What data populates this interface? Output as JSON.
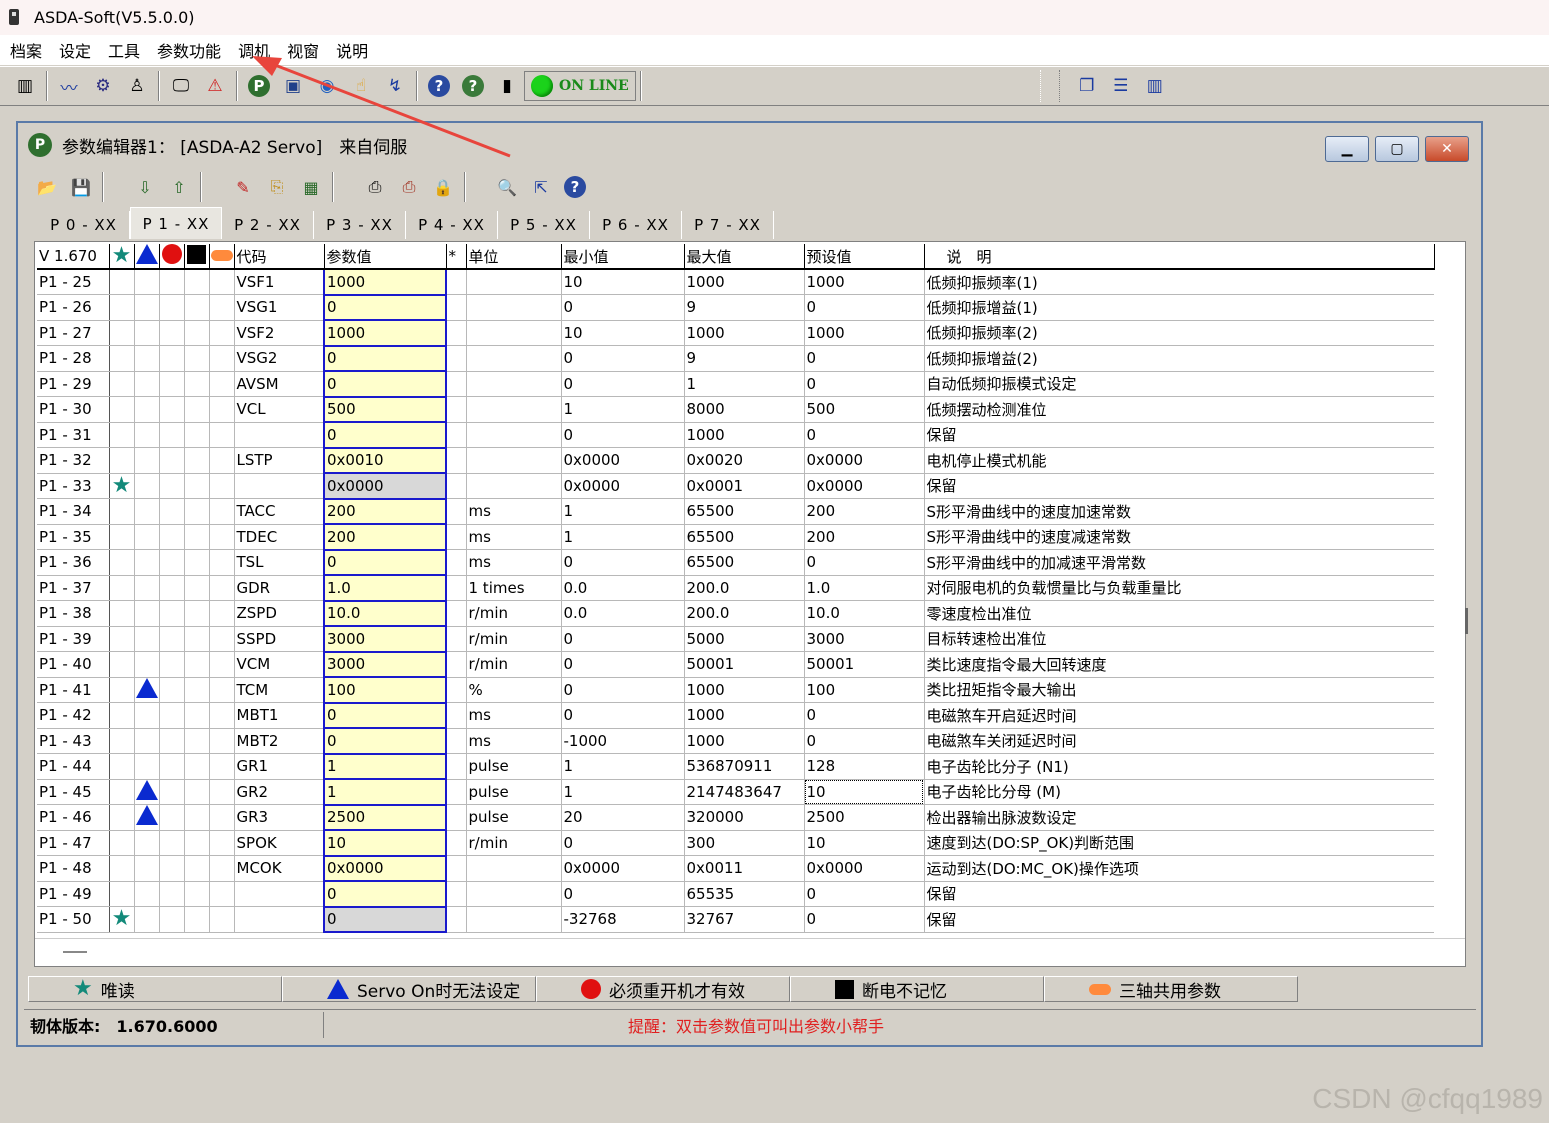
{
  "window": {
    "title": "ASDA-Soft(V5.5.0.0)"
  },
  "menubar": {
    "items": [
      "档案",
      "设定",
      "工具",
      "参数功能",
      "调机",
      "视窗",
      "说明"
    ]
  },
  "toolbar": {
    "online_label": "ON LINE"
  },
  "editor": {
    "title": "参数编辑器1： [ASDA-A2 Servo]　来自伺服",
    "tabs": [
      "P 0 - XX",
      "P 1 - XX",
      "P 2 - XX",
      "P 3 - XX",
      "P 4 - XX",
      "P 5 - XX",
      "P 6 - XX",
      "P 7 - XX"
    ],
    "active_tab": 1,
    "columns": {
      "version": "V 1.670",
      "code": "代码",
      "value": "参数值",
      "star": "*",
      "unit": "单位",
      "min": "最小值",
      "max": "最大值",
      "default": "预设值",
      "desc": "说　明"
    },
    "rows": [
      {
        "num": "P1 - 25",
        "code": "VSF1",
        "value": "1000",
        "unit": "",
        "min": "10",
        "max": "1000",
        "def": "1000",
        "desc": "低频抑振频率(1)",
        "flags": []
      },
      {
        "num": "P1 - 26",
        "code": "VSG1",
        "value": "0",
        "unit": "",
        "min": "0",
        "max": "9",
        "def": "0",
        "desc": "低频抑振增益(1)",
        "flags": []
      },
      {
        "num": "P1 - 27",
        "code": "VSF2",
        "value": "1000",
        "unit": "",
        "min": "10",
        "max": "1000",
        "def": "1000",
        "desc": "低频抑振频率(2)",
        "flags": []
      },
      {
        "num": "P1 - 28",
        "code": "VSG2",
        "value": "0",
        "unit": "",
        "min": "0",
        "max": "9",
        "def": "0",
        "desc": "低频抑振增益(2)",
        "flags": []
      },
      {
        "num": "P1 - 29",
        "code": "AVSM",
        "value": "0",
        "unit": "",
        "min": "0",
        "max": "1",
        "def": "0",
        "desc": "自动低频抑振模式设定",
        "flags": []
      },
      {
        "num": "P1 - 30",
        "code": "VCL",
        "value": "500",
        "unit": "",
        "min": "1",
        "max": "8000",
        "def": "500",
        "desc": "低频摆动检测准位",
        "flags": []
      },
      {
        "num": "P1 - 31",
        "code": "",
        "value": "0",
        "unit": "",
        "min": "0",
        "max": "1000",
        "def": "0",
        "desc": "保留",
        "flags": []
      },
      {
        "num": "P1 - 32",
        "code": "LSTP",
        "value": "0x0010",
        "unit": "",
        "min": "0x0000",
        "max": "0x0020",
        "def": "0x0000",
        "desc": "电机停止模式机能",
        "flags": []
      },
      {
        "num": "P1 - 33",
        "code": "",
        "value": "0x0000",
        "unit": "",
        "min": "0x0000",
        "max": "0x0001",
        "def": "0x0000",
        "desc": "保留",
        "flags": [
          "star"
        ],
        "readonly": true
      },
      {
        "num": "P1 - 34",
        "code": "TACC",
        "value": "200",
        "unit": "ms",
        "min": "1",
        "max": "65500",
        "def": "200",
        "desc": "S形平滑曲线中的速度加速常数",
        "flags": []
      },
      {
        "num": "P1 - 35",
        "code": "TDEC",
        "value": "200",
        "unit": "ms",
        "min": "1",
        "max": "65500",
        "def": "200",
        "desc": "S形平滑曲线中的速度减速常数",
        "flags": []
      },
      {
        "num": "P1 - 36",
        "code": "TSL",
        "value": "0",
        "unit": "ms",
        "min": "0",
        "max": "65500",
        "def": "0",
        "desc": "S形平滑曲线中的加减速平滑常数",
        "flags": []
      },
      {
        "num": "P1 - 37",
        "code": "GDR",
        "value": "1.0",
        "unit": "1 times",
        "min": "0.0",
        "max": "200.0",
        "def": "1.0",
        "desc": "对伺服电机的负载惯量比与负载重量比",
        "flags": []
      },
      {
        "num": "P1 - 38",
        "code": "ZSPD",
        "value": "10.0",
        "unit": "r/min",
        "min": "0.0",
        "max": "200.0",
        "def": "10.0",
        "desc": "零速度检出准位",
        "flags": []
      },
      {
        "num": "P1 - 39",
        "code": "SSPD",
        "value": "3000",
        "unit": "r/min",
        "min": "0",
        "max": "5000",
        "def": "3000",
        "desc": "目标转速检出准位",
        "flags": []
      },
      {
        "num": "P1 - 40",
        "code": "VCM",
        "value": "3000",
        "unit": "r/min",
        "min": "0",
        "max": "50001",
        "def": "50001",
        "desc": "类比速度指令最大回转速度",
        "flags": []
      },
      {
        "num": "P1 - 41",
        "code": "TCM",
        "value": "100",
        "unit": "%",
        "min": "0",
        "max": "1000",
        "def": "100",
        "desc": "类比扭矩指令最大输出",
        "flags": [
          "tri"
        ]
      },
      {
        "num": "P1 - 42",
        "code": "MBT1",
        "value": "0",
        "unit": "ms",
        "min": "0",
        "max": "1000",
        "def": "0",
        "desc": "电磁煞车开启延迟时间",
        "flags": []
      },
      {
        "num": "P1 - 43",
        "code": "MBT2",
        "value": "0",
        "unit": "ms",
        "min": "-1000",
        "max": "1000",
        "def": "0",
        "desc": "电磁煞车关闭延迟时间",
        "flags": []
      },
      {
        "num": "P1 - 44",
        "code": "GR1",
        "value": "1",
        "unit": "pulse",
        "min": "1",
        "max": "536870911",
        "def": "128",
        "desc": "电子齿轮比分子 (N1)",
        "flags": []
      },
      {
        "num": "P1 - 45",
        "code": "GR2",
        "value": "1",
        "unit": "pulse",
        "min": "1",
        "max": "2147483647",
        "def": "10",
        "desc": "电子齿轮比分母 (M)",
        "flags": [
          "tri"
        ],
        "focus": true
      },
      {
        "num": "P1 - 46",
        "code": "GR3",
        "value": "2500",
        "unit": "pulse",
        "min": "20",
        "max": "320000",
        "def": "2500",
        "desc": "检出器输出脉波数设定",
        "flags": [
          "tri"
        ]
      },
      {
        "num": "P1 - 47",
        "code": "SPOK",
        "value": "10",
        "unit": "r/min",
        "min": "0",
        "max": "300",
        "def": "10",
        "desc": "速度到达(DO:SP_OK)判断范围",
        "flags": []
      },
      {
        "num": "P1 - 48",
        "code": "MCOK",
        "value": "0x0000",
        "unit": "",
        "min": "0x0000",
        "max": "0x0011",
        "def": "0x0000",
        "desc": "运动到达(DO:MC_OK)操作选项",
        "flags": []
      },
      {
        "num": "P1 - 49",
        "code": "",
        "value": "0",
        "unit": "",
        "min": "0",
        "max": "65535",
        "def": "0",
        "desc": "保留",
        "flags": []
      },
      {
        "num": "P1 - 50",
        "code": "",
        "value": "0",
        "unit": "",
        "min": "-32768",
        "max": "32767",
        "def": "0",
        "desc": "保留",
        "flags": [
          "star"
        ],
        "readonly": true
      }
    ],
    "legend": [
      "唯读",
      "Servo On时无法设定",
      "必须重开机才有效",
      "断电不记忆",
      "三轴共用参数"
    ],
    "status": {
      "firmware": "韧体版本:　1.670.6000",
      "hint": "提醒：双击参数值可叫出参数小帮手"
    }
  },
  "watermark": "CSDN @cfqq1989",
  "colors": {
    "star": "#138a7a",
    "triangle": "#0a2ad0",
    "circle": "#e01010",
    "pill": "#ff8a3c",
    "value_cell": "#ffffcc",
    "hint": "#e02020",
    "arrow": "#e8453c"
  }
}
